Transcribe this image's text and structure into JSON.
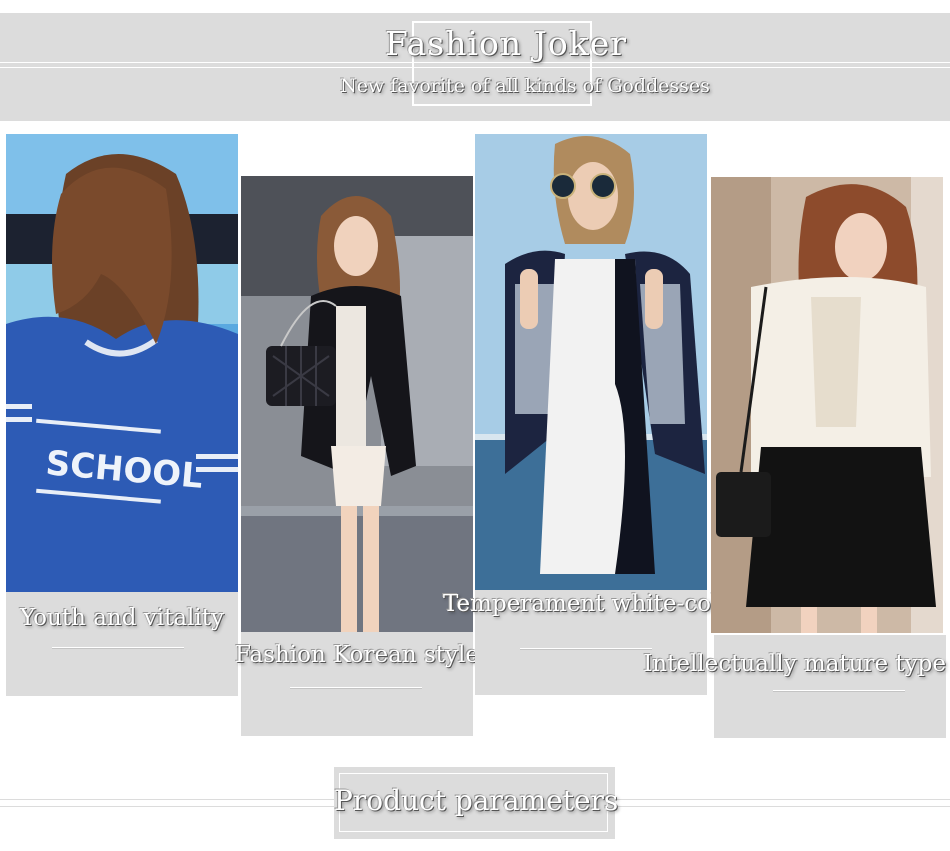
{
  "banner": {
    "title": "Fashion Joker",
    "subtitle": "New favorite of all kinds of Goddesses"
  },
  "cards": [
    {
      "label": "Youth and vitality",
      "shirt_text": "SCHOOL",
      "shirt_color": "#2d5bb5"
    },
    {
      "label": "Fashion Korean style",
      "jacket_color": "#15151a"
    },
    {
      "label": "Temperament white-collar",
      "dress_color": "#f2f2f2"
    },
    {
      "label": "Intellectually mature type",
      "blouse_color": "#f4efe6"
    }
  ],
  "footer": {
    "title": "Product parameters"
  },
  "colors": {
    "panel_gray": "#dcdcdc",
    "text_fill": "#ffffff"
  }
}
